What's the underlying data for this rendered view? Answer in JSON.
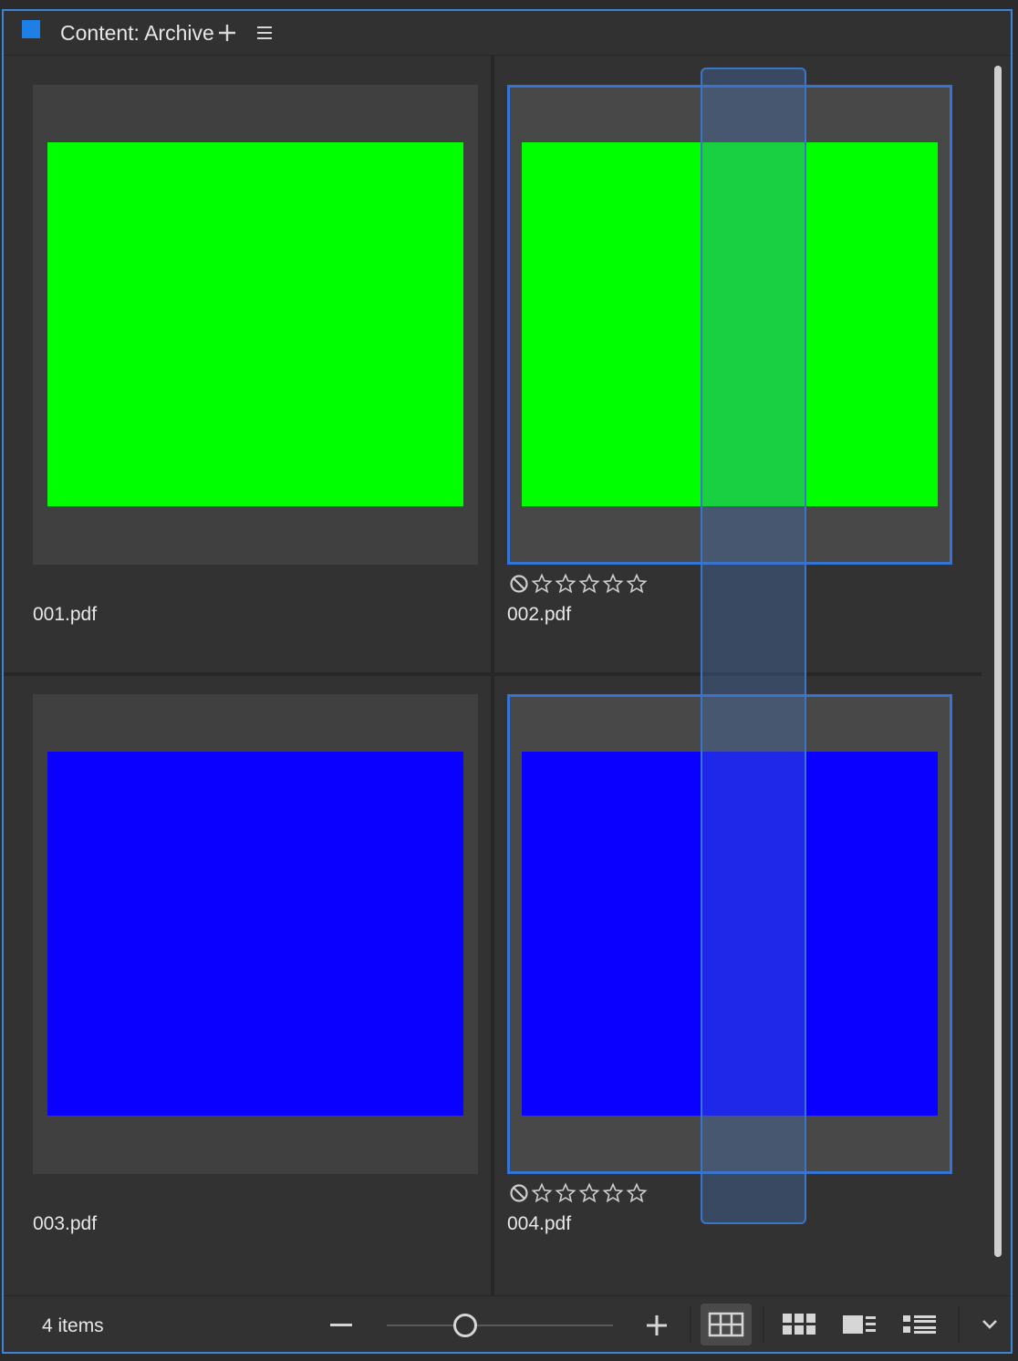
{
  "panel": {
    "title": "Content: Archive",
    "accent_color": "#3d86d6",
    "swatch_color": "#1e7fe6"
  },
  "header_icons": [
    "add-icon",
    "panel-menu-icon"
  ],
  "items": [
    {
      "filename": "001.pdf",
      "color": "#00ff00",
      "selected": false
    },
    {
      "filename": "002.pdf",
      "color": "#00ff00",
      "selected": true,
      "rating": 0
    },
    {
      "filename": "003.pdf",
      "color": "#0a00ff",
      "selected": false
    },
    {
      "filename": "004.pdf",
      "color": "#0a00ff",
      "selected": true,
      "rating": 0
    }
  ],
  "footer": {
    "item_count": "4 items",
    "zoom_level": 0.33,
    "views": [
      "grid-view-icon",
      "grid-view-small-icon",
      "filmstrip-view-icon",
      "list-view-icon"
    ],
    "active_view": "grid-view-icon"
  }
}
